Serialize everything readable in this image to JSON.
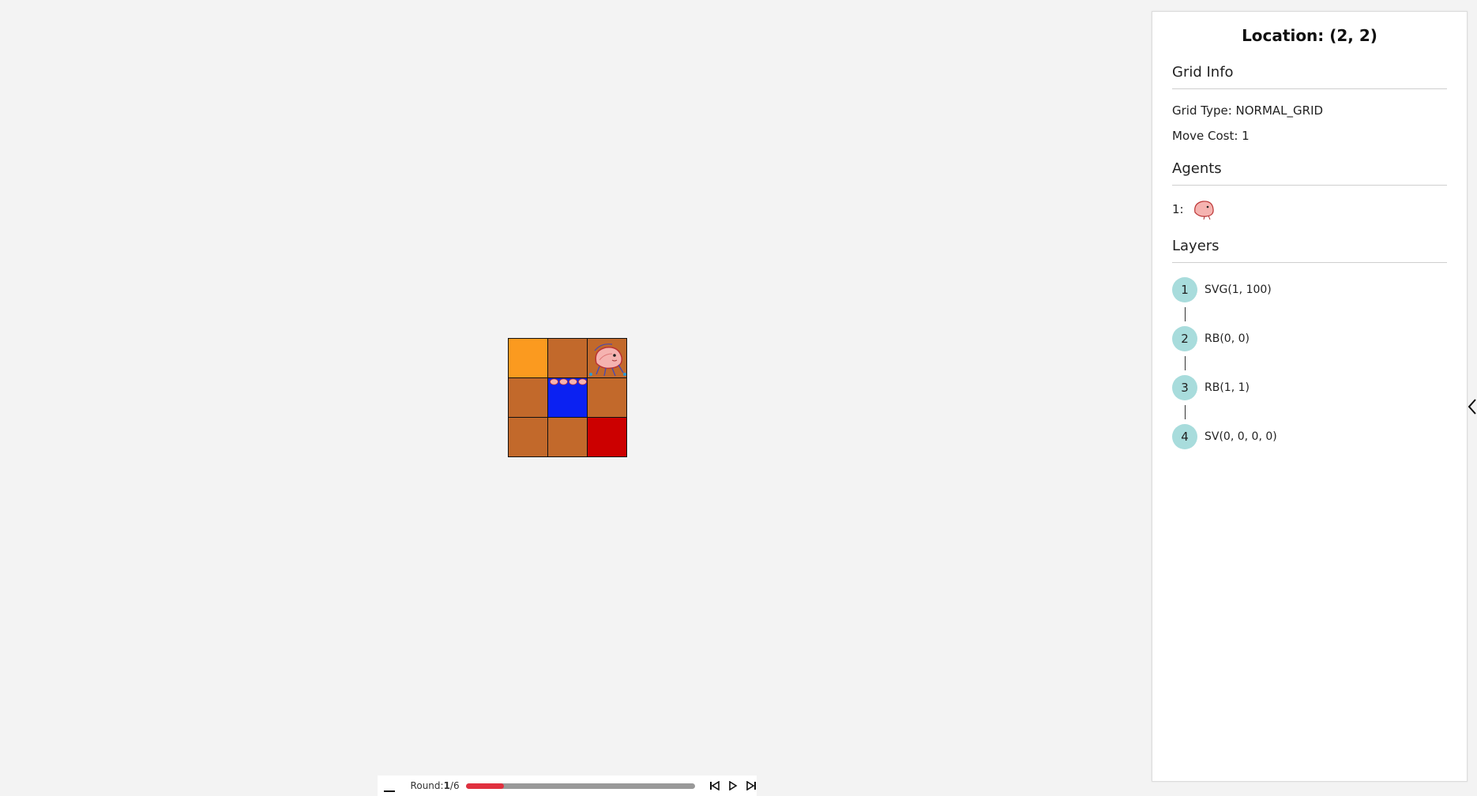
{
  "panel": {
    "title": "Location: (2, 2)",
    "grid_info": {
      "heading": "Grid Info",
      "grid_type": "Grid Type: NORMAL_GRID",
      "move_cost": "Move Cost: 1"
    },
    "agents": {
      "heading": "Agents",
      "items": [
        {
          "label": "1:",
          "icon": "agent-avatar-icon"
        }
      ]
    },
    "layers": {
      "heading": "Layers",
      "items": [
        {
          "num": "1",
          "label": "SVG(1, 100)"
        },
        {
          "num": "2",
          "label": "RB(0, 0)"
        },
        {
          "num": "3",
          "label": "RB(1, 1)"
        },
        {
          "num": "4",
          "label": "SV(0, 0, 0, 0)"
        }
      ]
    },
    "toggle_icon": "chevron-left-icon"
  },
  "grid": {
    "rows": 3,
    "cols": 3,
    "cells": [
      [
        "orange",
        "brown",
        "brown"
      ],
      [
        "brown",
        "blue",
        "brown"
      ],
      [
        "brown",
        "brown",
        "red"
      ]
    ],
    "colors": {
      "orange": "#fb9a1f",
      "brown": "#c2692b",
      "blue": "#0b21f2",
      "red": "#cc0000"
    }
  },
  "playback": {
    "round_prefix": "Round:",
    "round_current": "1",
    "round_total": "/6",
    "progress_fraction": 0.167,
    "progress_color": "#e0303f",
    "icons": [
      "collapse-icon",
      "skip-back-icon",
      "play-icon",
      "skip-forward-icon"
    ]
  }
}
